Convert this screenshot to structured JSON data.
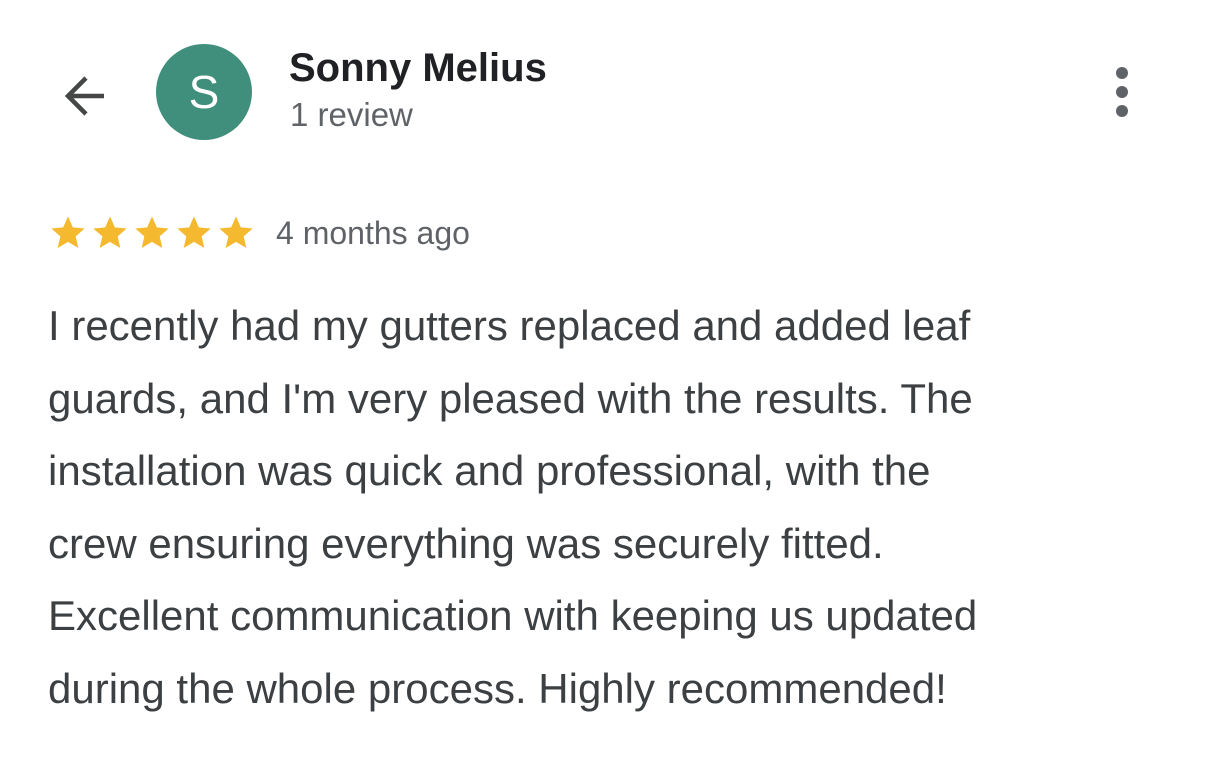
{
  "header": {
    "back_icon": "arrow-left-icon",
    "avatar": {
      "initial": "S",
      "color": "#3f8f7c"
    },
    "reviewer_name": "Sonny Melius",
    "review_count": "1 review",
    "more_icon": "more-vert-icon"
  },
  "review": {
    "rating": 5,
    "max_rating": 5,
    "star_color": "#f4b92e",
    "timestamp": "4 months ago",
    "text": "I recently had my gutters replaced and added leaf\nguards, and I'm very pleased with the results. The\ninstallation was quick and professional, with the\ncrew ensuring everything was securely fitted.\nExcellent communication with keeping us updated\nduring the whole process. Highly recommended!"
  }
}
